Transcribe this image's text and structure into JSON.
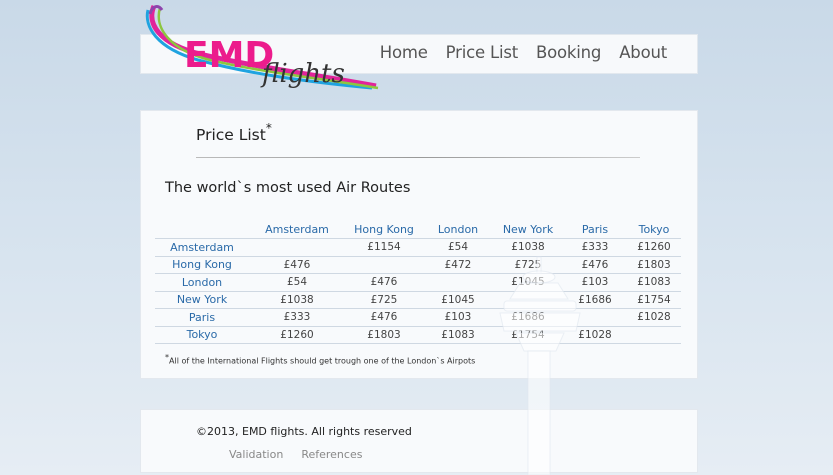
{
  "logo": {
    "brand": "EMD",
    "tagline": "flights"
  },
  "nav": {
    "items": [
      "Home",
      "Price List",
      "Booking",
      "About"
    ]
  },
  "page": {
    "title": "Price List",
    "title_mark": "*"
  },
  "routes": {
    "heading": "The world`s most used Air Routes",
    "columns": [
      "Amsterdam",
      "Hong Kong",
      "London",
      "New York",
      "Paris",
      "Tokyo"
    ],
    "rows": [
      {
        "city": "Amsterdam",
        "values": [
          "",
          "£1154",
          "£54",
          "£1038",
          "£333",
          "£1260"
        ]
      },
      {
        "city": "Hong Kong",
        "values": [
          "£476",
          "",
          "£472",
          "£725",
          "£476",
          "£1803"
        ]
      },
      {
        "city": "London",
        "values": [
          "£54",
          "£476",
          "",
          "£1045",
          "£103",
          "£1083"
        ]
      },
      {
        "city": "New York",
        "values": [
          "£1038",
          "£725",
          "£1045",
          "",
          "£1686",
          "£1754"
        ]
      },
      {
        "city": "Paris",
        "values": [
          "£333",
          "£476",
          "£103",
          "£1686",
          "",
          "£1028"
        ]
      },
      {
        "city": "Tokyo",
        "values": [
          "£1260",
          "£1803",
          "£1083",
          "£1754",
          "£1028",
          ""
        ]
      }
    ],
    "footnote_mark": "*",
    "footnote": "All of the International Flights should get trough one of the London`s Airpots"
  },
  "footer": {
    "copyright": "©2013, EMD flights. All rights reserved",
    "links": [
      "Validation",
      "References"
    ]
  }
}
